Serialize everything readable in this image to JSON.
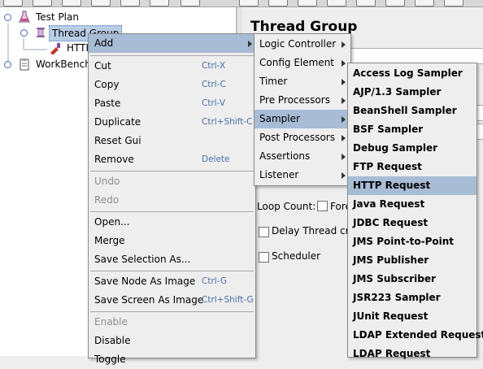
{
  "tree": {
    "test_plan": "Test Plan",
    "thread_group": "Thread Group",
    "http_item": "HTTP",
    "workbench": "WorkBench"
  },
  "right_panel": {
    "title": "Thread Group",
    "loop_count_label": "Loop Count:",
    "forever_label": "Fore",
    "delay_label": "Delay Thread cre",
    "scheduler_label": "Scheduler"
  },
  "context_menu": {
    "add": "Add",
    "cut": "Cut",
    "cut_acc": "Ctrl-X",
    "copy": "Copy",
    "copy_acc": "Ctrl-C",
    "paste": "Paste",
    "paste_acc": "Ctrl-V",
    "duplicate": "Duplicate",
    "duplicate_acc": "Ctrl+Shift-C",
    "reset_gui": "Reset Gui",
    "remove": "Remove",
    "remove_acc": "Delete",
    "undo": "Undo",
    "redo": "Redo",
    "open": "Open...",
    "merge": "Merge",
    "save_selection": "Save Selection As...",
    "save_node_image": "Save Node As Image",
    "save_node_image_acc": "Ctrl-G",
    "save_screen_image": "Save Screen As Image",
    "save_screen_image_acc": "Ctrl+Shift-G",
    "enable": "Enable",
    "disable": "Disable",
    "toggle": "Toggle"
  },
  "add_submenu": [
    "Logic Controller",
    "Config Element",
    "Timer",
    "Pre Processors",
    "Sampler",
    "Post Processors",
    "Assertions",
    "Listener"
  ],
  "sampler_submenu": [
    "Access Log Sampler",
    "AJP/1.3 Sampler",
    "BeanShell Sampler",
    "BSF Sampler",
    "Debug Sampler",
    "FTP Request",
    "HTTP Request",
    "Java Request",
    "JDBC Request",
    "JMS Point-to-Point",
    "JMS Publisher",
    "JMS Subscriber",
    "JSR223 Sampler",
    "JUnit Request",
    "LDAP Extended Request",
    "LDAP Request"
  ],
  "colors": {
    "highlight": "#a8bcd6",
    "accelerator": "#4a6fa6",
    "disabled": "#8e8e8e"
  }
}
